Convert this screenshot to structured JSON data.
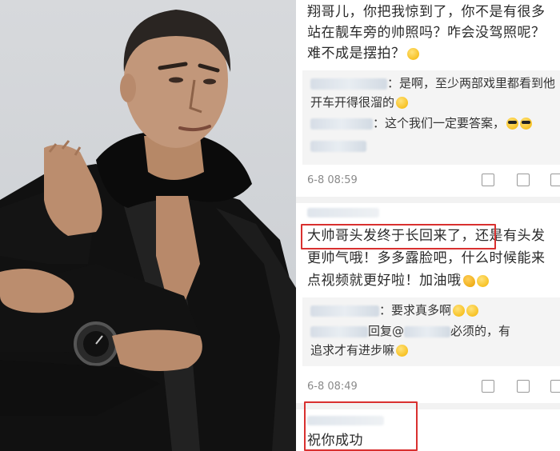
{
  "comment1": {
    "lines": [
      "翔哥儿，你把我惊到了，你不是有很多",
      "站在靓车旁的帅照吗？咋会没驾照呢？",
      "难不成是摆拍？"
    ],
    "replies": [
      {
        "text": "：是啊，至少两部戏里都看到他"
      },
      {
        "text": "开车开得很溜的"
      },
      {
        "text": "：这个我们一定要答案，"
      }
    ],
    "time": "6-8 08:59"
  },
  "comment2": {
    "lines": [
      "大帅哥头发终于长回来了，还是有头发",
      "更帅气哦！多多露脸吧，什么时候能来",
      "点视频就更好啦！加油哦"
    ],
    "replies": [
      {
        "text": "：要求真多啊"
      },
      {
        "text": "回复@",
        "suffix": "必须的，有"
      },
      {
        "text": "追求才有进步嘛"
      }
    ],
    "time": "6-8 08:49"
  },
  "comment3": {
    "lines": [
      "祝你成功"
    ]
  },
  "colors": {
    "highlight": "#d9302f",
    "time": "#8a8a8a",
    "reply_bg": "#f4f4f4"
  }
}
